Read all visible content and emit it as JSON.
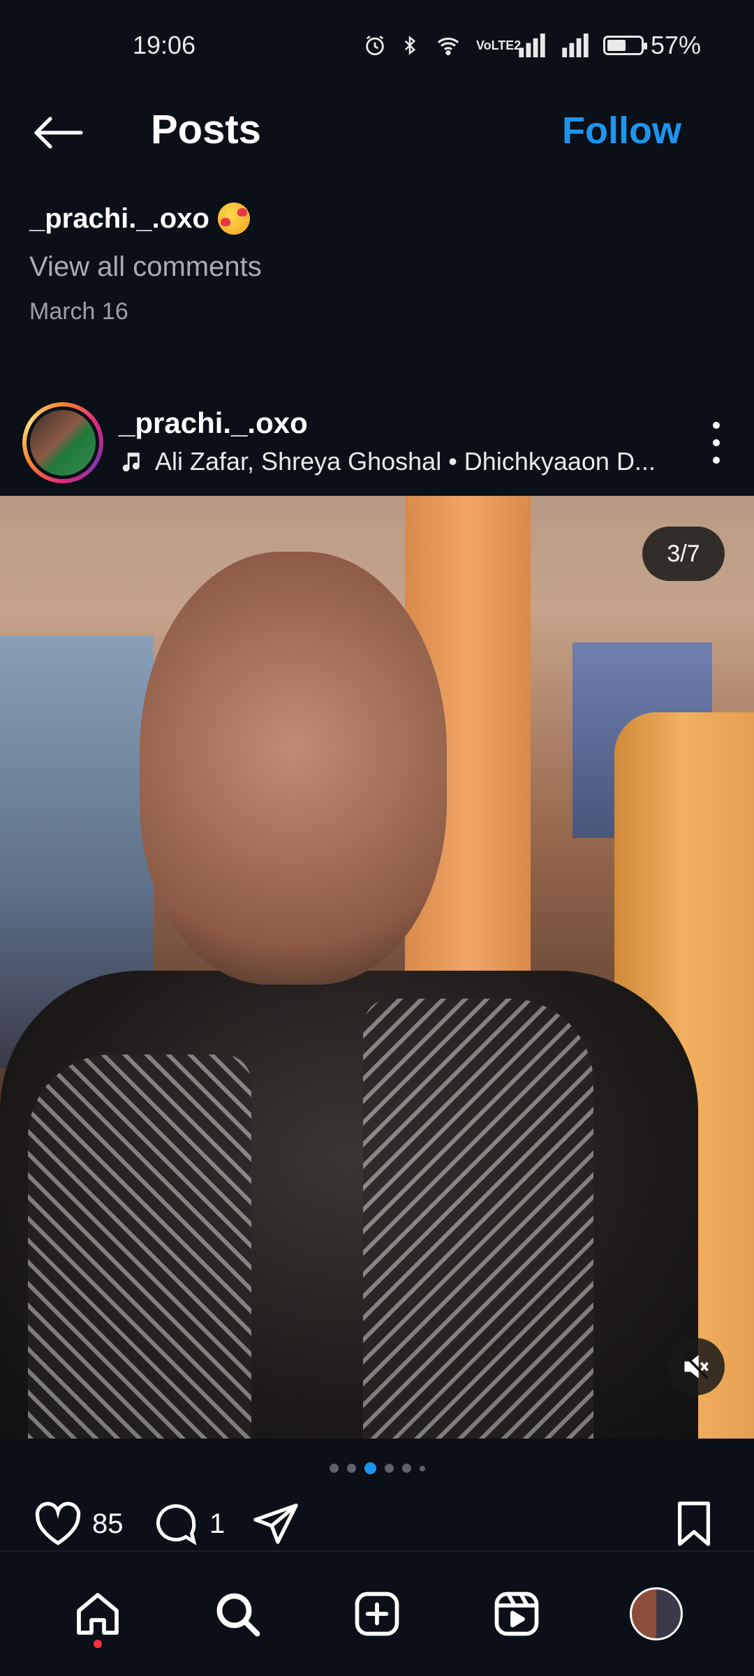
{
  "status_bar": {
    "time": "19:06",
    "icons": [
      "alarm-icon",
      "bluetooth-icon",
      "wifi-icon",
      "volte-icon",
      "signal-icon",
      "signal-icon",
      "battery-icon"
    ],
    "network_label": "VoLTE2",
    "battery_percent": "57%",
    "battery_level": 0.57
  },
  "header": {
    "title": "Posts",
    "follow_label": "Follow"
  },
  "previous_post": {
    "username": "_prachi._.oxo",
    "emoji": "smiling-face-with-hearts",
    "view_comments": "View all comments",
    "date": "March 16"
  },
  "post": {
    "username": "_prachi._.oxo",
    "music": "Ali Zafar, Shreya Ghoshal • Dhichkyaaon D...",
    "carousel_counter": "3/7",
    "carousel_current": 3,
    "carousel_total": 7,
    "likes": "85",
    "comments": "1"
  },
  "colors": {
    "accent": "#1b96f0",
    "background": "#0b0f17",
    "notification_dot": "#ff3040"
  },
  "bottom_nav": [
    "home-icon",
    "search-icon",
    "create-icon",
    "reels-icon",
    "profile-avatar"
  ]
}
